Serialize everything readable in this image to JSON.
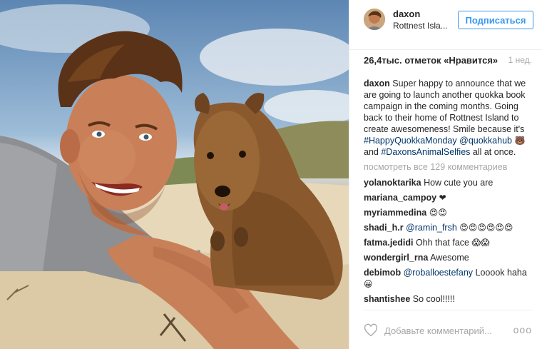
{
  "post": {
    "image_subject": "selfie-with-quokka-photo",
    "header": {
      "username": "daxon",
      "location": "Rottnest Isla...",
      "follow_label": "Подписаться"
    },
    "likes_text": "26,4тыс. отметок «Нравится»",
    "timestamp": "1 нед.",
    "caption": {
      "username": "daxon",
      "text_1": " Super happy to announce that we are going to launch another quokka book campaign in the coming months. Going back to their home of Rottnest Island to create awesomeness! Smile because it's ",
      "hashtag_1": "#HappyQuokkaMonday",
      "mention_1": "@quokkahub",
      "emoji_1": "🐻",
      "text_2": " and ",
      "hashtag_2": "#DaxonsAnimalSelfies",
      "text_3": " all at once."
    },
    "view_all_comments": "посмотреть все 129 комментариев",
    "comments": [
      {
        "username": "yolanoktarika",
        "text": "How cute you are",
        "mention": "",
        "emoji": ""
      },
      {
        "username": "mariana_campoy",
        "text": "",
        "mention": "",
        "emoji": "❤"
      },
      {
        "username": "myriammedina",
        "text": "",
        "mention": "",
        "emoji": "😍😍"
      },
      {
        "username": "shadi_h.r",
        "text": "",
        "mention": "@ramin_frsh",
        "emoji": "😍😍😍😍😍😍"
      },
      {
        "username": "fatma.jedidi",
        "text": "Ohh that face",
        "mention": "",
        "emoji": "😱😱"
      },
      {
        "username": "wondergirl_rna",
        "text": "Awesome",
        "mention": "",
        "emoji": ""
      },
      {
        "username": "debimob",
        "text": "Looook haha",
        "mention": "@roballoestefany",
        "emoji": "😀"
      },
      {
        "username": "shantishee",
        "text": "So cool!!!!!",
        "mention": "",
        "emoji": ""
      }
    ],
    "add_comment_placeholder": "Добавьте комментарий...",
    "more_options": "ooo"
  },
  "colors": {
    "accent": "#3897f0",
    "link": "#003569",
    "muted": "#a5a7aa",
    "text": "#262626"
  }
}
